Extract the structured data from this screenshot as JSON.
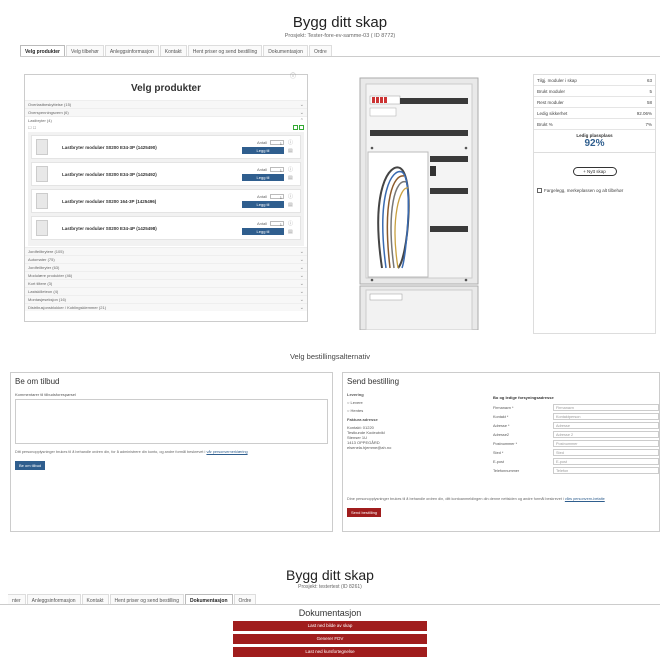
{
  "app": {
    "title": "Bygg ditt skap",
    "subtitle": "Prosjekt: Tester-fore-ev-samme-03 ( ID 8772)"
  },
  "tabs": [
    "Velg produkter",
    "Velg tilbehør",
    "Anleggsinformasjon",
    "Kontakt",
    "Hent priser og send bestilling",
    "Dokumentasjon",
    "Ordre"
  ],
  "left": {
    "heading": "Velg produkter",
    "categories_top": [
      {
        "label": "Overlastbeskyttelse  (15)"
      },
      {
        "label": "Overspenningsvern  (6)"
      }
    ],
    "open_category": "Lastbryter  (4)",
    "products": [
      {
        "name": "Lastbryter modulær S0200 E34-3P  (1425490)",
        "antall_label": "Antall",
        "qty": "1",
        "button": "Legg til"
      },
      {
        "name": "Lastbryter modulær S0200 E34-3P  (1425492)",
        "antall_label": "Antall",
        "qty": "1",
        "button": "Legg til"
      },
      {
        "name": "Lastbryter modulær S0200 164-3P  (1425496)",
        "antall_label": "Antall",
        "qty": "1",
        "button": "Legg til"
      },
      {
        "name": "Lastbryter modulær S0200 E34-4P  (1425498)",
        "antall_label": "Antall",
        "qty": "1",
        "button": "Legg til"
      }
    ],
    "categories_bottom": [
      {
        "label": "Jordfeilbrytere  (105)"
      },
      {
        "label": "Automater  (75)"
      },
      {
        "label": "Jordfeilbryter  (63)"
      },
      {
        "label": "Modulære produkter  (46)"
      },
      {
        "label": "Kort tiltere  (3)"
      },
      {
        "label": "Lastskilleteon  (4)"
      },
      {
        "label": "Montasjeseksjon  (16)"
      },
      {
        "label": "Distribusjonsblokker / Koblingsklemmer  (21)"
      }
    ]
  },
  "right": {
    "stats": [
      {
        "label": "Tilgj. moduler i skap",
        "value": "63"
      },
      {
        "label": "Brukt moduler",
        "value": "5"
      },
      {
        "label": "Rest moduler",
        "value": "58"
      },
      {
        "label": "Ledig sikkerhet",
        "value": "92.06%"
      },
      {
        "label": "Brukt %",
        "value": "7%"
      }
    ],
    "capacity_label": "Ledig plassplass",
    "capacity_value": "92%",
    "new_button": "+ Nytt skap",
    "checkbox_label": "Fargelegg, merkeplassen og alt tilbehør"
  },
  "order": {
    "title": "Velg bestillingsalternativ",
    "left_heading": "Be om tilbud",
    "comment_label": "Kommentarer til tilbudsforespørsel",
    "privacy_text": "Ditt personopplysninger brukes til å behandle ordren din, for å administrere din konto, og andre formål beskrevet i",
    "privacy_link": "vår personvernerklæring",
    "quote_button": "Be om tilbud",
    "right_heading": "Send bestilling",
    "delivery_label": "Levering",
    "delivery_opts": [
      "Levere",
      "Hentes"
    ],
    "invoice_label": "Faktura adresse",
    "invoice_lines": [
      "Kontakt: 01220",
      "Testkunde Kodeutvikl",
      "Stenser 1U",
      "1413 OPPEGÅRD",
      "elsenela.hjemme@ah.no"
    ],
    "form_head": "Bo og ledige forsyningsadresse",
    "form_fields": [
      {
        "label": "Firmanavn *",
        "placeholder": "Firmanavn"
      },
      {
        "label": "Kontakt *",
        "placeholder": "Kontaktperson"
      },
      {
        "label": "Adresse *",
        "placeholder": "Adresse"
      },
      {
        "label": "Adresse2",
        "placeholder": "Adresse 2"
      },
      {
        "label": "Postnummer *",
        "placeholder": "Postnummer"
      },
      {
        "label": "Sted *",
        "placeholder": "Sted"
      },
      {
        "label": "E-post",
        "placeholder": "E-post"
      },
      {
        "label": "Telefonnummer",
        "placeholder": "Telefon"
      }
    ],
    "privacy_text_2": "Dine personopplysninger brukes til å behandle ordren din, ditt kontoanmeldingen din denne nettsiden og andre formål beskrevet i",
    "privacy_link_2": "vårs personvern-betalte",
    "send_button": "Send bestilling"
  },
  "docs": {
    "title": "Bygg ditt skap",
    "subtitle": "Prosjekt: testertest (ID 8261)",
    "tabs": [
      "nter",
      "Anleggsinformasjon",
      "Kontakt",
      "Hent priser og send bestilling",
      "Dokumentasjon",
      "Ordre"
    ],
    "heading": "Dokumentasjon",
    "buttons": [
      "Last ned bilde av skap",
      "Generer FDV",
      "Last ned kursfortegnelse"
    ]
  }
}
